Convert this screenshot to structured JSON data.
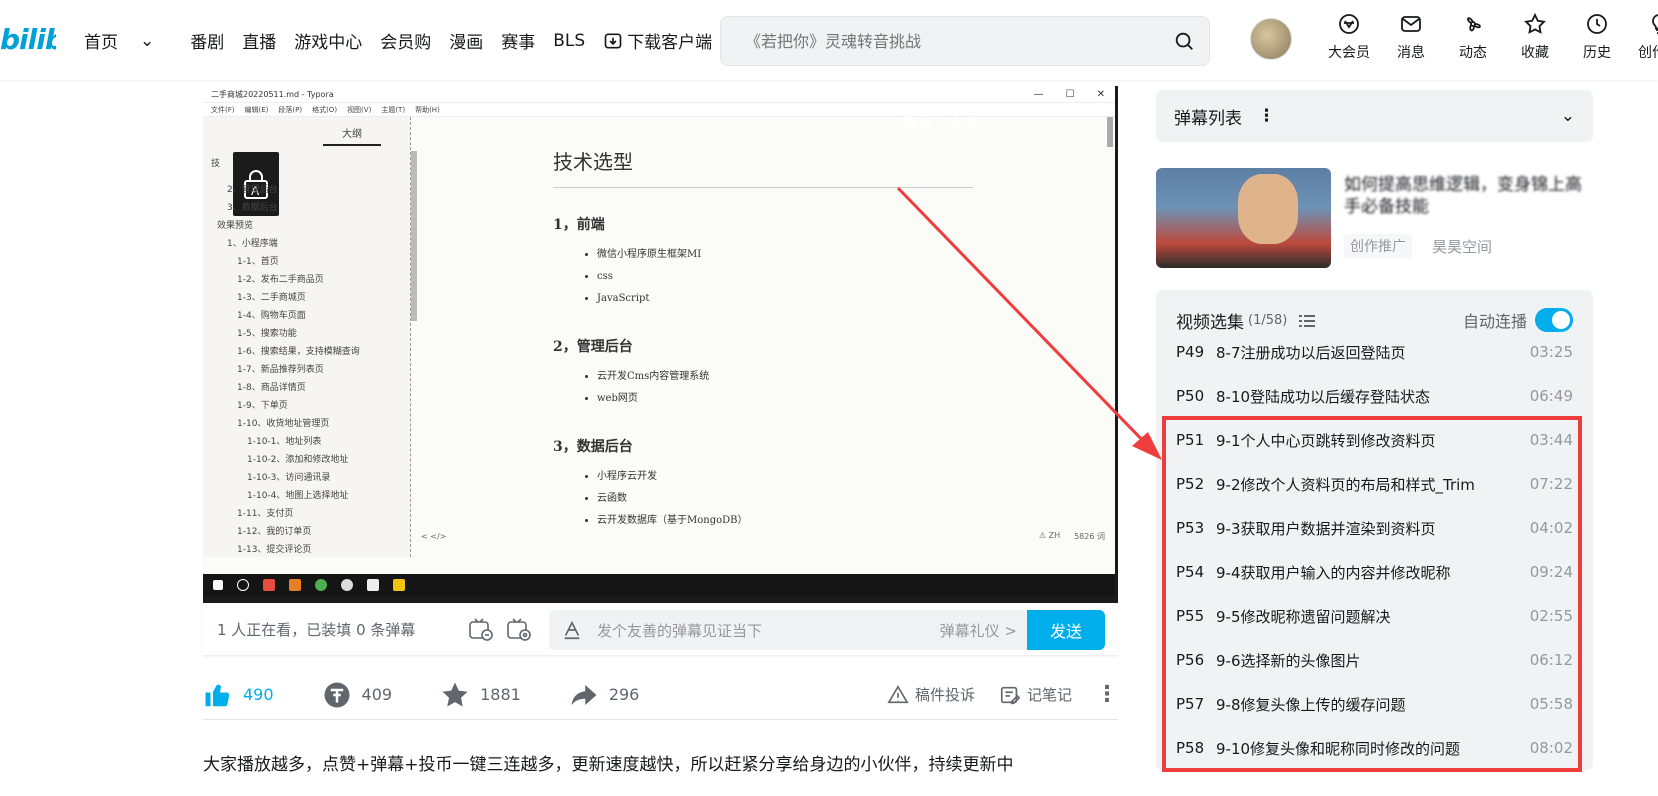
{
  "header": {
    "logo": "bilibili",
    "nav": [
      {
        "label": "首页",
        "dropdown": true
      },
      {
        "label": "番剧"
      },
      {
        "label": "直播"
      },
      {
        "label": "游戏中心"
      },
      {
        "label": "会员购"
      },
      {
        "label": "漫画"
      },
      {
        "label": "赛事"
      },
      {
        "label": "BLS"
      },
      {
        "label": "下载客户端",
        "icon": "download-icon"
      }
    ],
    "search_placeholder": "《若把你》灵魂转音挑战",
    "right_nav": [
      {
        "label": "大会员",
        "icon": "vip-icon"
      },
      {
        "label": "消息",
        "icon": "message-icon"
      },
      {
        "label": "动态",
        "icon": "activity-icon"
      },
      {
        "label": "收藏",
        "icon": "star-icon"
      },
      {
        "label": "历史",
        "icon": "clock-icon"
      },
      {
        "label": "创作中",
        "icon": "bulb-icon"
      }
    ]
  },
  "video": {
    "app_title": "二手商城20220511.md - Typora",
    "menu": [
      "文件(F)",
      "编辑(E)",
      "段落(P)",
      "格式(O)",
      "视图(V)",
      "主题(T)",
      "帮助(H)"
    ],
    "outline_header": "大纲",
    "outline_items": [
      "技",
      "2、管理后台",
      "3、数据后台",
      "效果预览",
      "1、小程序端",
      "1-1、首页",
      "1-2、发布二手商品页",
      "1-3、二手商城页",
      "1-4、购物车页面",
      "1-5、搜索功能",
      "1-6、搜索结果，支持模糊查询",
      "1-7、新品推荐列表页",
      "1-8、商品详情页",
      "1-9、下单页",
      "1-10、收货地址管理页",
      "1-10-1、地址列表",
      "1-10-2、添加和修改地址",
      "1-10-3、访问通讯录",
      "1-10-4、地图上选择地址",
      "1-11、支付页",
      "1-12、我的订单页",
      "1-13、提交评论页"
    ],
    "doc_title": "技术选型",
    "sections": [
      {
        "heading": "1，前端",
        "items": [
          "微信小程序原生框架MI",
          "css",
          "JavaScript"
        ]
      },
      {
        "heading": "2，管理后台",
        "items": [
          "云开发Cms内容管理系统",
          "web网页"
        ]
      },
      {
        "heading": "3，数据后台",
        "items": [
          "小程序云开发",
          "云函数",
          "云开发数据库（基于MongoDB）"
        ]
      }
    ],
    "watermark": "编程小石头",
    "status_left": "< </>",
    "status_right_warn": "ZH",
    "status_right_words": "5826 词"
  },
  "danmaku_bar": {
    "viewers": "1 人正在看，已装填 0 条弹幕",
    "input_placeholder": "发个友善的弹幕见证当下",
    "etiquette": "弹幕礼仪 >",
    "send": "发送"
  },
  "actions": {
    "like": "490",
    "coin": "409",
    "fav": "1881",
    "share": "296",
    "report": "稿件投诉",
    "notes": "记笔记"
  },
  "description": "大家播放越多，点赞+弹幕+投币一键三连越多，更新速度越快，所以赶紧分享给身边的小伙伴，持续更新中",
  "sidebar": {
    "danmaku_list": "弹幕列表",
    "ad": {
      "title": "如何提高思维逻辑，变身锦上高手必备技能",
      "tag": "创作推广",
      "owner": "昊昊空间"
    },
    "playlist": {
      "title": "视频选集",
      "count": "(1/58)",
      "autoplay": "自动连播",
      "episodes": [
        {
          "p": "P49",
          "title": "8-7注册成功以后返回登陆页",
          "dur": "03:25"
        },
        {
          "p": "P50",
          "title": "8-10登陆成功以后缓存登陆状态",
          "dur": "06:49"
        },
        {
          "p": "P51",
          "title": "9-1个人中心页跳转到修改资料页",
          "dur": "03:44"
        },
        {
          "p": "P52",
          "title": "9-2修改个人资料页的布局和样式_Trim",
          "dur": "07:22"
        },
        {
          "p": "P53",
          "title": "9-3获取用户数据并渲染到资料页",
          "dur": "04:02"
        },
        {
          "p": "P54",
          "title": "9-4获取用户输入的内容并修改昵称",
          "dur": "09:24"
        },
        {
          "p": "P55",
          "title": "9-5修改昵称遗留问题解决",
          "dur": "02:55"
        },
        {
          "p": "P56",
          "title": "9-6选择新的头像图片",
          "dur": "06:12"
        },
        {
          "p": "P57",
          "title": "9-8修复头像上传的缓存问题",
          "dur": "05:58"
        },
        {
          "p": "P58",
          "title": "9-10修复头像和昵称同时修改的问题",
          "dur": "08:02"
        }
      ]
    }
  },
  "colors": {
    "brand": "#00aeec",
    "annotation_red": "#ef3d3d"
  }
}
